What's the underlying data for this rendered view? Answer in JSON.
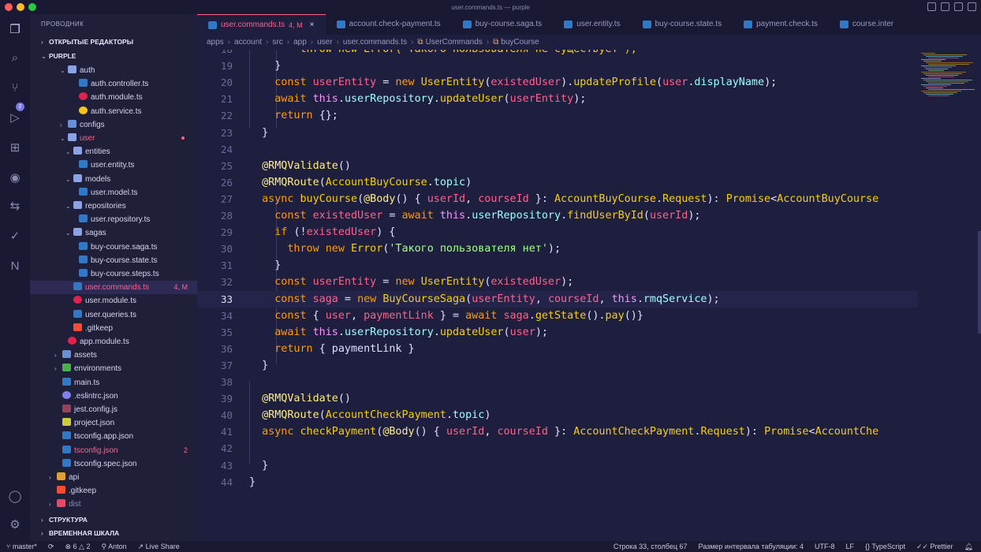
{
  "window": {
    "title": "user.commands.ts — purple"
  },
  "sidebar": {
    "header": "ПРОВОДНИК",
    "open_editors": "ОТКРЫТЫЕ РЕДАКТОРЫ",
    "project": "PURPLE",
    "structure": "СТРУКТУРА",
    "timeline": "ВРЕМЕННАЯ ШКАЛА",
    "tree": [
      {
        "label": "auth",
        "icon": "folder-open"
      },
      {
        "label": "auth.controller.ts",
        "icon": "nest-file"
      },
      {
        "label": "auth.module.ts",
        "icon": "nest-module"
      },
      {
        "label": "auth.service.ts",
        "icon": "nest-service"
      },
      {
        "label": "configs",
        "icon": "folder"
      },
      {
        "label": "user",
        "icon": "folder-open"
      },
      {
        "label": "entities",
        "icon": "folder-open"
      },
      {
        "label": "user.entity.ts",
        "icon": "ts-file"
      },
      {
        "label": "models",
        "icon": "folder-open"
      },
      {
        "label": "user.model.ts",
        "icon": "ts-file"
      },
      {
        "label": "repositories",
        "icon": "folder-open"
      },
      {
        "label": "user.repository.ts",
        "icon": "ts-file"
      },
      {
        "label": "sagas",
        "icon": "folder-open"
      },
      {
        "label": "buy-course.saga.ts",
        "icon": "ts-file"
      },
      {
        "label": "buy-course.state.ts",
        "icon": "ts-file"
      },
      {
        "label": "buy-course.steps.ts",
        "icon": "ts-file"
      },
      {
        "label": "user.commands.ts",
        "icon": "ts-file",
        "badge": "4, M"
      },
      {
        "label": "user.module.ts",
        "icon": "nest-module"
      },
      {
        "label": "user.queries.ts",
        "icon": "ts-file"
      },
      {
        "label": ".gitkeep",
        "icon": "git-file"
      },
      {
        "label": "app.module.ts",
        "icon": "nest-module"
      },
      {
        "label": "assets",
        "icon": "folder"
      },
      {
        "label": "environments",
        "icon": "folder"
      },
      {
        "label": "main.ts",
        "icon": "ts-file"
      },
      {
        "label": ".eslintrc.json",
        "icon": "eslint-file"
      },
      {
        "label": "jest.config.js",
        "icon": "jest-file"
      },
      {
        "label": "project.json",
        "icon": "json-file"
      },
      {
        "label": "tsconfig.app.json",
        "icon": "ts-config"
      },
      {
        "label": "tsconfig.json",
        "icon": "ts-config",
        "badge": "2"
      },
      {
        "label": "tsconfig.spec.json",
        "icon": "ts-config"
      },
      {
        "label": "api",
        "icon": "folder"
      },
      {
        "label": ".gitkeep",
        "icon": "git-file"
      },
      {
        "label": "dist",
        "icon": "folder"
      }
    ]
  },
  "tabs": [
    {
      "label": "user.commands.ts",
      "badge": "4, M"
    },
    {
      "label": "account.check-payment.ts"
    },
    {
      "label": "buy-course.saga.ts"
    },
    {
      "label": "user.entity.ts"
    },
    {
      "label": "buy-course.state.ts"
    },
    {
      "label": "payment.check.ts"
    },
    {
      "label": "course.inter"
    }
  ],
  "breadcrumb": [
    "apps",
    "account",
    "src",
    "app",
    "user",
    "user.commands.ts",
    "UserCommands",
    "buyCourse"
  ],
  "code": {
    "line_numbers": [
      "18",
      "19",
      "20",
      "21",
      "22",
      "23",
      "24",
      "25",
      "26",
      "27",
      "28",
      "29",
      "30",
      "31",
      "32",
      "33",
      "34",
      "35",
      "36",
      "37",
      "38",
      "39",
      "40",
      "41",
      "42",
      "43",
      "44"
    ]
  },
  "status": {
    "branch": "master*",
    "errors": "6",
    "warnings": "2",
    "user": "Anton",
    "live_share": "Live Share",
    "position": "Строка 33, столбец 67",
    "indent": "Размер интервала табуляции: 4",
    "encoding": "UTF-8",
    "eol": "LF",
    "language": "TypeScript",
    "formatter": "Prettier"
  },
  "colors": {
    "background": "#1e1e3f",
    "accent": "#ff628c",
    "keyword": "#ff9d00",
    "class": "#fad000",
    "string": "#a5ff90"
  }
}
